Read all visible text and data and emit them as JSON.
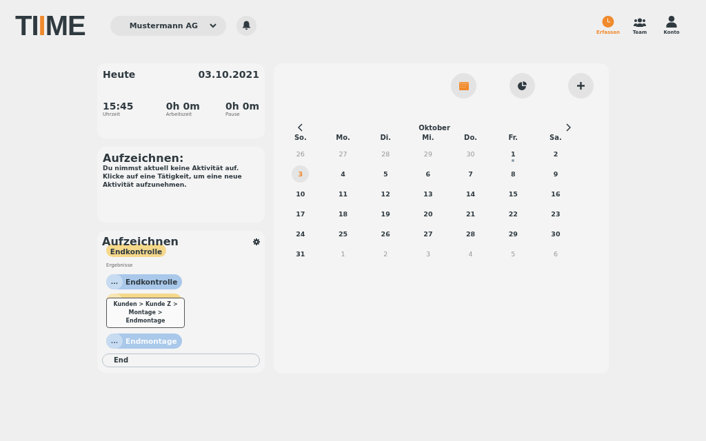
{
  "logo": {
    "parts": [
      {
        "text": "TI",
        "accent": false
      },
      {
        "text": "I",
        "accent": true
      },
      {
        "text": "ME",
        "accent": false
      }
    ]
  },
  "company_select": {
    "value": "Mustermann AG"
  },
  "nav": [
    {
      "label": "Erfassen",
      "kind": "clock",
      "selected": true
    },
    {
      "label": "Team",
      "kind": "team",
      "selected": false
    },
    {
      "label": "Konto",
      "kind": "user",
      "selected": false
    }
  ],
  "today_card": {
    "title": "Heute",
    "date": "03.10.2021",
    "stats": [
      {
        "value": "15:45",
        "label": "Uhrzeit"
      },
      {
        "value": "0h 0m",
        "label": "Arbeitszeit"
      },
      {
        "value": "0h 0m",
        "label": "Pause"
      }
    ]
  },
  "status_card": {
    "title": "Aufzeichnen:",
    "text": "Du nimmst aktuell keine Aktivität auf. Klicke auf eine Tätigkeit, um eine neue Aktivität aufzunehmen."
  },
  "record_card": {
    "title": "Aufzeichnen",
    "top_chip": {
      "label": "Endkontrolle",
      "color": "#f5d88a"
    },
    "results_label": "Ergebnisse",
    "results": [
      {
        "label": "Endkontrolle",
        "more": "...",
        "color": "#a9c8ea",
        "faded": false
      },
      {
        "color": "#f5d88a",
        "faded": false
      },
      {
        "label": "Endmontage",
        "more": "...",
        "color": "#a9c8ea",
        "faded": true
      }
    ],
    "tooltip": "Kunden > Kunde Z > Montage > Endmontage",
    "search": {
      "value": "End"
    }
  },
  "calendar": {
    "toolbar": [
      {
        "kind": "calendar",
        "selected": true
      },
      {
        "kind": "chart",
        "selected": false
      },
      {
        "kind": "add",
        "selected": false
      }
    ],
    "month": "Oktober",
    "weekdays": [
      "So.",
      "Mo.",
      "Di.",
      "Mi.",
      "Do.",
      "Fr.",
      "Sa."
    ],
    "weeks": [
      [
        {
          "day": "26",
          "outside": true,
          "selected": false,
          "event": false
        },
        {
          "day": "27",
          "outside": true,
          "selected": false,
          "event": false
        },
        {
          "day": "28",
          "outside": true,
          "selected": false,
          "event": false
        },
        {
          "day": "29",
          "outside": true,
          "selected": false,
          "event": false
        },
        {
          "day": "30",
          "outside": true,
          "selected": false,
          "event": false
        },
        {
          "day": "1",
          "outside": false,
          "selected": false,
          "event": true
        },
        {
          "day": "2",
          "outside": false,
          "selected": false,
          "event": false
        }
      ],
      [
        {
          "day": "3",
          "outside": false,
          "selected": true,
          "event": false
        },
        {
          "day": "4",
          "outside": false,
          "selected": false,
          "event": false
        },
        {
          "day": "5",
          "outside": false,
          "selected": false,
          "event": false
        },
        {
          "day": "6",
          "outside": false,
          "selected": false,
          "event": false
        },
        {
          "day": "7",
          "outside": false,
          "selected": false,
          "event": false
        },
        {
          "day": "8",
          "outside": false,
          "selected": false,
          "event": false
        },
        {
          "day": "9",
          "outside": false,
          "selected": false,
          "event": false
        }
      ],
      [
        {
          "day": "10",
          "outside": false,
          "selected": false,
          "event": false
        },
        {
          "day": "11",
          "outside": false,
          "selected": false,
          "event": false
        },
        {
          "day": "12",
          "outside": false,
          "selected": false,
          "event": false
        },
        {
          "day": "13",
          "outside": false,
          "selected": false,
          "event": false
        },
        {
          "day": "14",
          "outside": false,
          "selected": false,
          "event": false
        },
        {
          "day": "15",
          "outside": false,
          "selected": false,
          "event": false
        },
        {
          "day": "16",
          "outside": false,
          "selected": false,
          "event": false
        }
      ],
      [
        {
          "day": "17",
          "outside": false,
          "selected": false,
          "event": false
        },
        {
          "day": "18",
          "outside": false,
          "selected": false,
          "event": false
        },
        {
          "day": "19",
          "outside": false,
          "selected": false,
          "event": false
        },
        {
          "day": "20",
          "outside": false,
          "selected": false,
          "event": false
        },
        {
          "day": "21",
          "outside": false,
          "selected": false,
          "event": false
        },
        {
          "day": "22",
          "outside": false,
          "selected": false,
          "event": false
        },
        {
          "day": "23",
          "outside": false,
          "selected": false,
          "event": false
        }
      ],
      [
        {
          "day": "24",
          "outside": false,
          "selected": false,
          "event": false
        },
        {
          "day": "25",
          "outside": false,
          "selected": false,
          "event": false
        },
        {
          "day": "26",
          "outside": false,
          "selected": false,
          "event": false
        },
        {
          "day": "27",
          "outside": false,
          "selected": false,
          "event": false
        },
        {
          "day": "28",
          "outside": false,
          "selected": false,
          "event": false
        },
        {
          "day": "29",
          "outside": false,
          "selected": false,
          "event": false
        },
        {
          "day": "30",
          "outside": false,
          "selected": false,
          "event": false
        }
      ],
      [
        {
          "day": "31",
          "outside": false,
          "selected": false,
          "event": false
        },
        {
          "day": "1",
          "outside": true,
          "selected": false,
          "event": false
        },
        {
          "day": "2",
          "outside": true,
          "selected": false,
          "event": false
        },
        {
          "day": "3",
          "outside": true,
          "selected": false,
          "event": false
        },
        {
          "day": "4",
          "outside": true,
          "selected": false,
          "event": false
        },
        {
          "day": "5",
          "outside": true,
          "selected": false,
          "event": false
        },
        {
          "day": "6",
          "outside": true,
          "selected": false,
          "event": false
        }
      ]
    ]
  }
}
